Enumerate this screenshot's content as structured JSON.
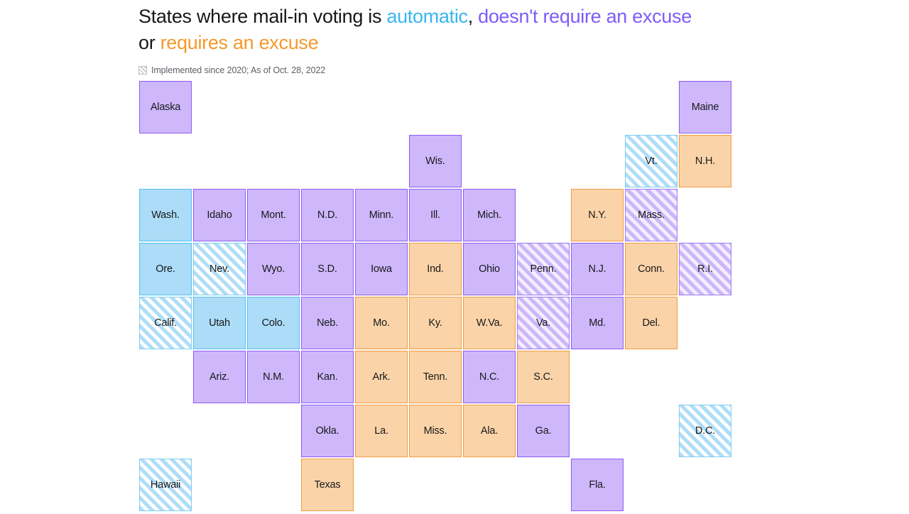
{
  "header": {
    "title_parts": {
      "lead": "States where mail-in voting is ",
      "automatic": "automatic",
      "comma": ", ",
      "no_excuse": "doesn't require an excuse",
      "or": "or ",
      "excuse": "requires an excuse"
    },
    "subtitle": "Implemented since 2020; As of Oct. 28, 2022",
    "hatch_legend_icon": "diagonal-hatch-swatch"
  },
  "colors": {
    "automatic_text": "#38B6F1",
    "no_excuse_text": "#7C5CFA",
    "excuse_text": "#F49A2B",
    "automatic_fill": "#ACDCF8",
    "no_excuse_fill": "#CEB8FB",
    "excuse_fill": "#FBD3A8",
    "automatic_border": "#4FC0F0",
    "no_excuse_border": "#8B5CF6",
    "excuse_border": "#F09A3E",
    "title_text": "#17181A",
    "subtitle_text": "#5C5F66",
    "background": "#FFFFFF"
  },
  "legend_categories": [
    {
      "key": "automatic",
      "label": "automatic"
    },
    {
      "key": "no_excuse",
      "label": "doesn't require an excuse"
    },
    {
      "key": "excuse",
      "label": "requires an excuse"
    }
  ],
  "chart_data": {
    "type": "table",
    "title": "States where mail-in voting is automatic, doesn't require an excuse or requires an excuse",
    "subtitle": "Implemented since 2020; As of Oct. 28, 2022",
    "legend_position": "title-inline",
    "grid": {
      "columns": 12,
      "rows": 8,
      "cell_size": 74,
      "cell_pitch": 76
    },
    "encoding": {
      "fill": "category",
      "hatch": "implemented since 2020"
    },
    "categories": [
      "automatic",
      "no_excuse",
      "excuse"
    ],
    "cells": [
      {
        "label": "Alaska",
        "category": "no_excuse",
        "hatched": false,
        "col": 0,
        "row": 0
      },
      {
        "label": "Maine",
        "category": "no_excuse",
        "hatched": false,
        "col": 10,
        "row": 0
      },
      {
        "label": "Wis.",
        "category": "no_excuse",
        "hatched": false,
        "col": 5,
        "row": 1
      },
      {
        "label": "Vt.",
        "category": "automatic",
        "hatched": true,
        "col": 9,
        "row": 1
      },
      {
        "label": "N.H.",
        "category": "excuse",
        "hatched": false,
        "col": 10,
        "row": 1
      },
      {
        "label": "Wash.",
        "category": "automatic",
        "hatched": false,
        "col": 0,
        "row": 2
      },
      {
        "label": "Idaho",
        "category": "no_excuse",
        "hatched": false,
        "col": 1,
        "row": 2
      },
      {
        "label": "Mont.",
        "category": "no_excuse",
        "hatched": false,
        "col": 2,
        "row": 2
      },
      {
        "label": "N.D.",
        "category": "no_excuse",
        "hatched": false,
        "col": 3,
        "row": 2
      },
      {
        "label": "Minn.",
        "category": "no_excuse",
        "hatched": false,
        "col": 4,
        "row": 2
      },
      {
        "label": "Ill.",
        "category": "no_excuse",
        "hatched": false,
        "col": 5,
        "row": 2
      },
      {
        "label": "Mich.",
        "category": "no_excuse",
        "hatched": false,
        "col": 6,
        "row": 2
      },
      {
        "label": "N.Y.",
        "category": "excuse",
        "hatched": false,
        "col": 8,
        "row": 2
      },
      {
        "label": "Mass.",
        "category": "no_excuse",
        "hatched": true,
        "col": 9,
        "row": 2
      },
      {
        "label": "Ore.",
        "category": "automatic",
        "hatched": false,
        "col": 0,
        "row": 3
      },
      {
        "label": "Nev.",
        "category": "automatic",
        "hatched": true,
        "col": 1,
        "row": 3
      },
      {
        "label": "Wyo.",
        "category": "no_excuse",
        "hatched": false,
        "col": 2,
        "row": 3
      },
      {
        "label": "S.D.",
        "category": "no_excuse",
        "hatched": false,
        "col": 3,
        "row": 3
      },
      {
        "label": "Iowa",
        "category": "no_excuse",
        "hatched": false,
        "col": 4,
        "row": 3
      },
      {
        "label": "Ind.",
        "category": "excuse",
        "hatched": false,
        "col": 5,
        "row": 3
      },
      {
        "label": "Ohio",
        "category": "no_excuse",
        "hatched": false,
        "col": 6,
        "row": 3
      },
      {
        "label": "Penn.",
        "category": "no_excuse",
        "hatched": true,
        "col": 7,
        "row": 3
      },
      {
        "label": "N.J.",
        "category": "no_excuse",
        "hatched": false,
        "col": 8,
        "row": 3
      },
      {
        "label": "Conn.",
        "category": "excuse",
        "hatched": false,
        "col": 9,
        "row": 3
      },
      {
        "label": "R.I.",
        "category": "no_excuse",
        "hatched": true,
        "col": 10,
        "row": 3
      },
      {
        "label": "Calif.",
        "category": "automatic",
        "hatched": true,
        "col": 0,
        "row": 4
      },
      {
        "label": "Utah",
        "category": "automatic",
        "hatched": false,
        "col": 1,
        "row": 4
      },
      {
        "label": "Colo.",
        "category": "automatic",
        "hatched": false,
        "col": 2,
        "row": 4
      },
      {
        "label": "Neb.",
        "category": "no_excuse",
        "hatched": false,
        "col": 3,
        "row": 4
      },
      {
        "label": "Mo.",
        "category": "excuse",
        "hatched": false,
        "col": 4,
        "row": 4
      },
      {
        "label": "Ky.",
        "category": "excuse",
        "hatched": false,
        "col": 5,
        "row": 4
      },
      {
        "label": "W.Va.",
        "category": "excuse",
        "hatched": false,
        "col": 6,
        "row": 4
      },
      {
        "label": "Va.",
        "category": "no_excuse",
        "hatched": true,
        "col": 7,
        "row": 4
      },
      {
        "label": "Md.",
        "category": "no_excuse",
        "hatched": false,
        "col": 8,
        "row": 4
      },
      {
        "label": "Del.",
        "category": "excuse",
        "hatched": false,
        "col": 9,
        "row": 4
      },
      {
        "label": "Ariz.",
        "category": "no_excuse",
        "hatched": false,
        "col": 1,
        "row": 5
      },
      {
        "label": "N.M.",
        "category": "no_excuse",
        "hatched": false,
        "col": 2,
        "row": 5
      },
      {
        "label": "Kan.",
        "category": "no_excuse",
        "hatched": false,
        "col": 3,
        "row": 5
      },
      {
        "label": "Ark.",
        "category": "excuse",
        "hatched": false,
        "col": 4,
        "row": 5
      },
      {
        "label": "Tenn.",
        "category": "excuse",
        "hatched": false,
        "col": 5,
        "row": 5
      },
      {
        "label": "N.C.",
        "category": "no_excuse",
        "hatched": false,
        "col": 6,
        "row": 5
      },
      {
        "label": "S.C.",
        "category": "excuse",
        "hatched": false,
        "col": 7,
        "row": 5
      },
      {
        "label": "Okla.",
        "category": "no_excuse",
        "hatched": false,
        "col": 3,
        "row": 6
      },
      {
        "label": "La.",
        "category": "excuse",
        "hatched": false,
        "col": 4,
        "row": 6
      },
      {
        "label": "Miss.",
        "category": "excuse",
        "hatched": false,
        "col": 5,
        "row": 6
      },
      {
        "label": "Ala.",
        "category": "excuse",
        "hatched": false,
        "col": 6,
        "row": 6
      },
      {
        "label": "Ga.",
        "category": "no_excuse",
        "hatched": false,
        "col": 7,
        "row": 6
      },
      {
        "label": "D.C.",
        "category": "automatic",
        "hatched": true,
        "col": 10,
        "row": 6
      },
      {
        "label": "Hawaii",
        "category": "automatic",
        "hatched": true,
        "col": 0,
        "row": 7
      },
      {
        "label": "Texas",
        "category": "excuse",
        "hatched": false,
        "col": 3,
        "row": 7
      },
      {
        "label": "Fla.",
        "category": "no_excuse",
        "hatched": false,
        "col": 8,
        "row": 7
      }
    ]
  }
}
